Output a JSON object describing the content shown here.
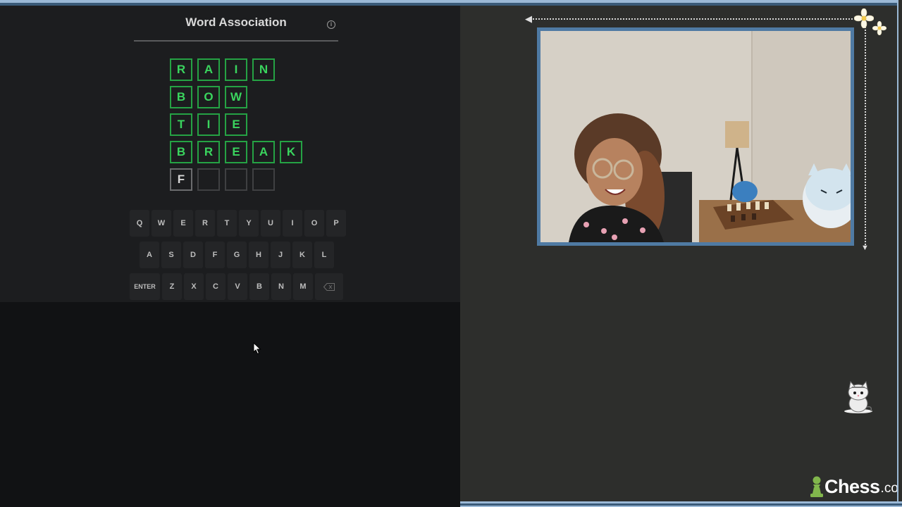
{
  "game": {
    "title": "Word Association",
    "info_icon": "info-icon",
    "rows": [
      {
        "letters": [
          "R",
          "A",
          "I",
          "N"
        ],
        "state": "solved"
      },
      {
        "letters": [
          "B",
          "O",
          "W"
        ],
        "state": "solved"
      },
      {
        "letters": [
          "T",
          "I",
          "E"
        ],
        "state": "solved"
      },
      {
        "letters": [
          "B",
          "R",
          "E",
          "A",
          "K"
        ],
        "state": "solved"
      },
      {
        "letters": [
          "F",
          "",
          "",
          ""
        ],
        "state": "active"
      }
    ],
    "keyboard": {
      "row1": [
        "Q",
        "W",
        "E",
        "R",
        "T",
        "Y",
        "U",
        "I",
        "O",
        "P"
      ],
      "row2": [
        "A",
        "S",
        "D",
        "F",
        "G",
        "H",
        "J",
        "K",
        "L"
      ],
      "row3_enter": "ENTER",
      "row3": [
        "Z",
        "X",
        "C",
        "V",
        "B",
        "N",
        "M"
      ],
      "backspace_icon": "backspace-icon"
    }
  },
  "stream": {
    "brand": {
      "name": "Chess",
      "suffix": ".com"
    },
    "decorations": [
      "flower-icon",
      "cat-sticker-icon",
      "pawn-logo-icon"
    ]
  },
  "colors": {
    "correct": "#3ad55e",
    "frame": "#4f7aa3",
    "accent_strip": "#9bb9d6"
  }
}
